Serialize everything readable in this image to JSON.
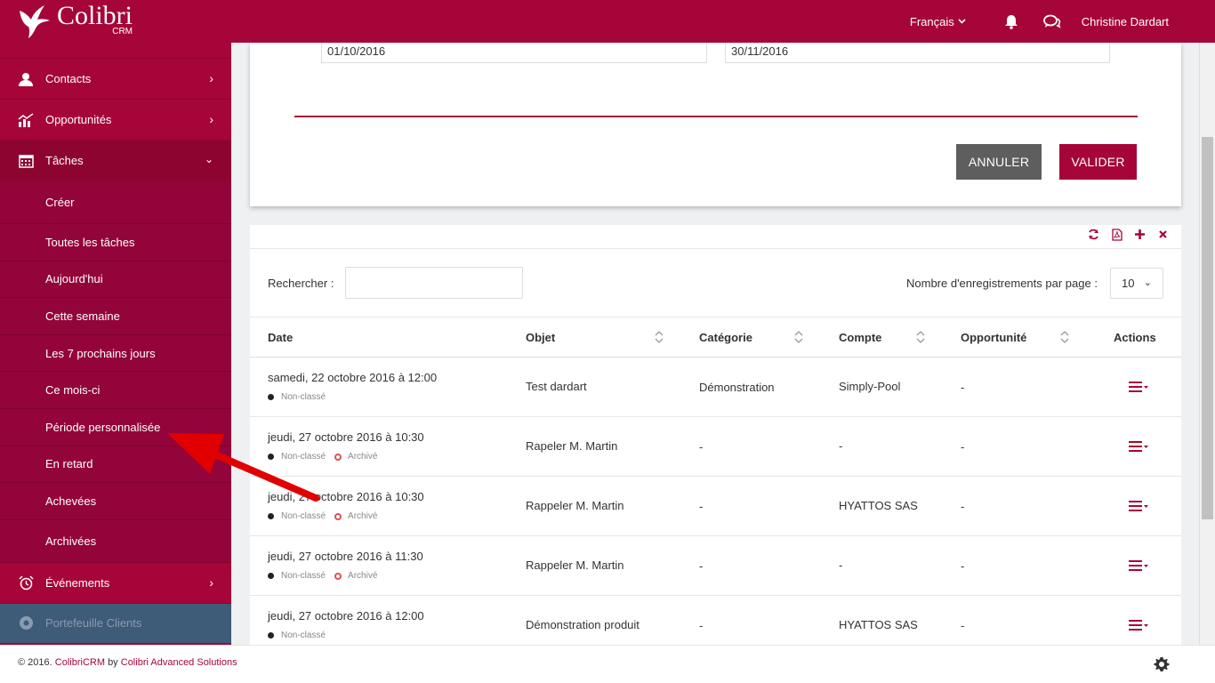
{
  "header": {
    "logo_name": "Colibri",
    "logo_sub": "CRM",
    "language": "Français",
    "user": "Christine Dardart"
  },
  "sidebar": {
    "items": [
      {
        "label": "Contacts",
        "icon": "contacts-icon"
      },
      {
        "label": "Opportunités",
        "icon": "chart-icon"
      },
      {
        "label": "Tâches",
        "icon": "calendar-icon"
      }
    ],
    "sub_items": [
      "Créer",
      "Toutes les tâches",
      "Aujourd'hui",
      "Cette semaine",
      "Les 7 prochains jours",
      "Ce mois-ci",
      "Période personnalisée",
      "En retard",
      "Achevées",
      "Archivées"
    ],
    "events_label": "Événements",
    "portfolio_label": "Portefeuille Clients"
  },
  "filter": {
    "date_from": "01/10/2016",
    "date_to": "30/11/2016",
    "cancel_label": "ANNULER",
    "ok_label": "VALIDER"
  },
  "table": {
    "search_label": "Rechercher :",
    "search_value": "",
    "per_page_label": "Nombre d'enregistrements par page :",
    "per_page_value": "10",
    "columns": [
      "Date",
      "Objet",
      "Catégorie",
      "Compte",
      "Opportunité",
      "Actions"
    ],
    "rows": [
      {
        "date": "samedi, 22 octobre 2016 à 12:00",
        "tag1": "Non-classé",
        "tag2": "",
        "objet": "Test dardart",
        "categorie": "Démonstration",
        "compte": "Simply-Pool",
        "opportunite": "-"
      },
      {
        "date": "jeudi, 27 octobre 2016 à 10:30",
        "tag1": "Non-classé",
        "tag2": "Archivé",
        "objet": "Rapeler M. Martin",
        "categorie": "-",
        "compte": "-",
        "opportunite": "-"
      },
      {
        "date": "jeudi, 27 octobre 2016 à 10:30",
        "tag1": "Non-classé",
        "tag2": "Archivé",
        "objet": "Rappeler M. Martin",
        "categorie": "-",
        "compte": "HYATTOS SAS",
        "opportunite": "-"
      },
      {
        "date": "jeudi, 27 octobre 2016 à 11:30",
        "tag1": "Non-classé",
        "tag2": "Archivé",
        "objet": "Rappeler M. Martin",
        "categorie": "-",
        "compte": "-",
        "opportunite": "-"
      },
      {
        "date": "jeudi, 27 octobre 2016 à 12:00",
        "tag1": "Non-classé",
        "tag2": "",
        "objet": "Démonstration produit",
        "categorie": "-",
        "compte": "HYATTOS SAS",
        "opportunite": "-"
      }
    ]
  },
  "footer": {
    "prefix": "© 2016.",
    "product": "ColibriCRM",
    "by": "by",
    "company": "Colibri Advanced Solutions"
  },
  "colors": {
    "brand": "#a6053a",
    "brand_dark": "#8e0431",
    "cancel": "#5e5e5e",
    "arrow": "#e00000"
  }
}
